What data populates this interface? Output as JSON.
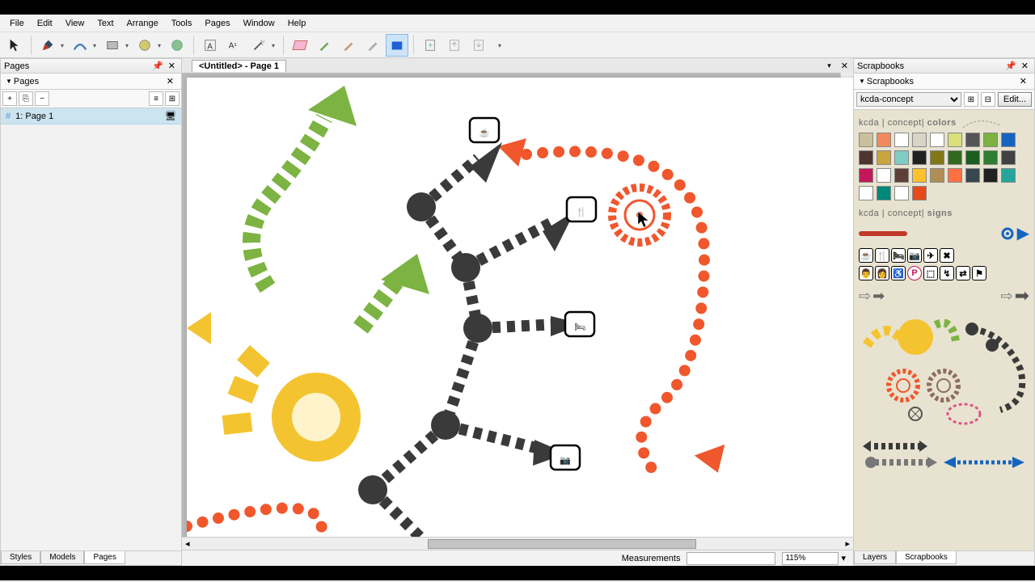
{
  "menu": {
    "file": "File",
    "edit": "Edit",
    "view": "View",
    "text": "Text",
    "arrange": "Arrange",
    "tools": "Tools",
    "pages": "Pages",
    "window": "Window",
    "help": "Help"
  },
  "panels": {
    "pages_title": "Pages",
    "pages_header": "Pages",
    "scrapbooks_title": "Scrapbooks",
    "scrapbooks_header": "Scrapbooks"
  },
  "pages": {
    "add": "+",
    "dup": "⎘",
    "del": "−",
    "item_prefix": "#",
    "item_label": "1: Page 1"
  },
  "doc": {
    "tab_label": "<Untitled> - Page 1"
  },
  "scrapbook": {
    "selected": "kcda-concept",
    "edit_btn": "Edit...",
    "colors_label_prefix": "kcda | concept|",
    "colors_label": "colors",
    "signs_label_prefix": "kcda | concept|",
    "signs_label": "signs",
    "colors": [
      "#c9bf9a",
      "#f08a5d",
      "#ffffff",
      "#d9d4c5",
      "#ffffff",
      "#d9e07a",
      "#555555",
      "#7cb342",
      "#1565c0",
      "#4e342e",
      "#c9a53d",
      "#80cbc4",
      "#212121",
      "#827717",
      "#33691e",
      "#1b5e20",
      "#2e7d32",
      "#424242",
      "#c2185b",
      "#ffffff",
      "#5d4037",
      "#fbc02d",
      "#b08d57",
      "#ff7043",
      "#37474f",
      "#212121",
      "#26a69a",
      "#ffffff",
      "#00897b",
      "#ffffff",
      "#e64a19"
    ],
    "sign_icons": [
      "☕",
      "🍴",
      "🛏",
      "📷",
      "✈",
      "✖",
      "👨",
      "👩",
      "♿",
      "P",
      "⬚",
      "↯",
      "⇄",
      "⚑"
    ]
  },
  "status": {
    "measurements_label": "Measurements",
    "zoom": "115%"
  },
  "bottom_tabs": {
    "styles": "Styles",
    "models": "Models",
    "pages": "Pages",
    "layers": "Layers",
    "scrapbooks": "Scrapbooks"
  }
}
